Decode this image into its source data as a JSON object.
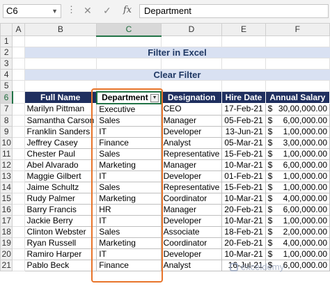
{
  "formula_bar": {
    "name_box": "C6",
    "formula": "Department"
  },
  "columns": [
    "A",
    "B",
    "C",
    "D",
    "E",
    "F"
  ],
  "rows": [
    "1",
    "2",
    "3",
    "4",
    "5",
    "6",
    "7",
    "8",
    "9",
    "10",
    "11",
    "12",
    "13",
    "14",
    "15",
    "16",
    "17",
    "18",
    "19",
    "20",
    "21"
  ],
  "title": "Filter in Excel",
  "subtitle": "Clear Filter",
  "table": {
    "headers": [
      "Full Name",
      "Department",
      "Designation",
      "Hire Date",
      "Annual Salary"
    ],
    "rows": [
      [
        "Marilyn Pittman",
        "Executive",
        "CEO",
        "17-Feb-21",
        "$",
        "30,00,000.00"
      ],
      [
        "Samantha Carson",
        "Sales",
        "Manager",
        "05-Feb-21",
        "$",
        "6,00,000.00"
      ],
      [
        "Franklin Sanders",
        "IT",
        "Developer",
        "13-Jun-21",
        "$",
        "1,00,000.00"
      ],
      [
        "Jeffrey Casey",
        "Finance",
        "Analyst",
        "05-Mar-21",
        "$",
        "3,00,000.00"
      ],
      [
        "Chester Paul",
        "Sales",
        "Representative",
        "15-Feb-21",
        "$",
        "1,00,000.00"
      ],
      [
        "Abel Alvarado",
        "Marketing",
        "Manager",
        "10-Mar-21",
        "$",
        "6,00,000.00"
      ],
      [
        "Maggie Gilbert",
        "IT",
        "Developer",
        "01-Feb-21",
        "$",
        "1,00,000.00"
      ],
      [
        "Jaime Schultz",
        "Sales",
        "Representative",
        "15-Feb-21",
        "$",
        "1,00,000.00"
      ],
      [
        "Rudy Palmer",
        "Marketing",
        "Coordinator",
        "10-Mar-21",
        "$",
        "4,00,000.00"
      ],
      [
        "Barry Francis",
        "HR",
        "Manager",
        "20-Feb-21",
        "$",
        "6,00,000.00"
      ],
      [
        "Jackie Berry",
        "IT",
        "Developer",
        "10-Mar-21",
        "$",
        "1,00,000.00"
      ],
      [
        "Clinton Webster",
        "Sales",
        "Associate",
        "18-Feb-21",
        "$",
        "2,00,000.00"
      ],
      [
        "Ryan Russell",
        "Marketing",
        "Coordinator",
        "20-Feb-21",
        "$",
        "4,00,000.00"
      ],
      [
        "Ramiro Harper",
        "IT",
        "Developer",
        "10-Mar-21",
        "$",
        "1,00,000.00"
      ],
      [
        "Pablo Beck",
        "Finance",
        "Analyst",
        "16-Jul-21",
        "$",
        "6,00,000.00"
      ]
    ]
  },
  "watermark": "exceldemy",
  "colors": {
    "header_bg": "#1f2f5f",
    "title_bg": "#d9e1f2",
    "highlight": "#e8742a",
    "select": "#217346"
  }
}
